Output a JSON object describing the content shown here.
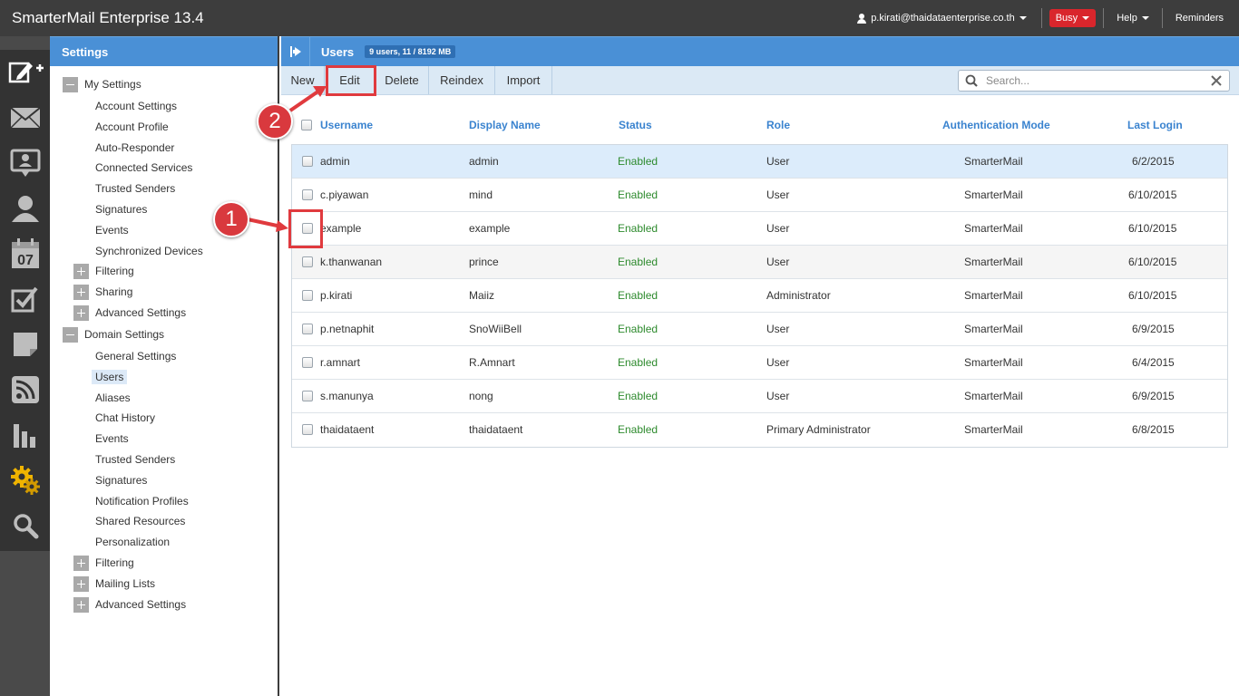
{
  "app": {
    "title": "SmarterMail Enterprise 13.4"
  },
  "topbar": {
    "user_email": "p.kirati@thaidataenterprise.co.th",
    "status_label": "Busy",
    "help_label": "Help",
    "reminders_label": "Reminders"
  },
  "rail": {
    "items": [
      "compose-icon",
      "mail-icon",
      "contacts-icon",
      "user-icon",
      "calendar-icon",
      "tasks-icon",
      "notes-icon",
      "rss-icon",
      "reports-icon",
      "settings-icon",
      "search-icon"
    ],
    "calendar_day": "07",
    "active": "settings-icon"
  },
  "settings": {
    "title": "Settings",
    "my_settings": {
      "label": "My Settings",
      "items": [
        "Account Settings",
        "Account Profile",
        "Auto-Responder",
        "Connected Services",
        "Trusted Senders",
        "Signatures",
        "Events",
        "Synchronized Devices"
      ],
      "groups": [
        "Filtering",
        "Sharing",
        "Advanced Settings"
      ]
    },
    "domain_settings": {
      "label": "Domain Settings",
      "items": [
        "General Settings",
        "Users",
        "Aliases",
        "Chat History",
        "Events",
        "Trusted Senders",
        "Signatures",
        "Notification Profiles",
        "Shared Resources",
        "Personalization"
      ],
      "groups": [
        "Filtering",
        "Mailing Lists",
        "Advanced Settings"
      ],
      "active_item": "Users"
    }
  },
  "main": {
    "title": "Users",
    "count_badge": "9 users, 11 / 8192 MB",
    "toolbar": {
      "new": "New",
      "edit": "Edit",
      "delete": "Delete",
      "reindex": "Reindex",
      "import": "Import"
    },
    "search": {
      "placeholder": "Search...",
      "value": ""
    },
    "columns": {
      "username": "Username",
      "display_name": "Display Name",
      "status": "Status",
      "role": "Role",
      "auth_mode": "Authentication Mode",
      "last_login": "Last Login"
    },
    "rows": [
      {
        "username": "admin",
        "display_name": "admin",
        "status": "Enabled",
        "role": "User",
        "auth_mode": "SmarterMail",
        "last_login": "6/2/2015"
      },
      {
        "username": "c.piyawan",
        "display_name": "mind",
        "status": "Enabled",
        "role": "User",
        "auth_mode": "SmarterMail",
        "last_login": "6/10/2015"
      },
      {
        "username": "example",
        "display_name": "example",
        "status": "Enabled",
        "role": "User",
        "auth_mode": "SmarterMail",
        "last_login": "6/10/2015"
      },
      {
        "username": "k.thanwanan",
        "display_name": "prince",
        "status": "Enabled",
        "role": "User",
        "auth_mode": "SmarterMail",
        "last_login": "6/10/2015"
      },
      {
        "username": "p.kirati",
        "display_name": "Maiiz",
        "status": "Enabled",
        "role": "Administrator",
        "auth_mode": "SmarterMail",
        "last_login": "6/10/2015"
      },
      {
        "username": "p.netnaphit",
        "display_name": "SnoWiiBell",
        "status": "Enabled",
        "role": "User",
        "auth_mode": "SmarterMail",
        "last_login": "6/9/2015"
      },
      {
        "username": "r.amnart",
        "display_name": "R.Amnart",
        "status": "Enabled",
        "role": "User",
        "auth_mode": "SmarterMail",
        "last_login": "6/4/2015"
      },
      {
        "username": "s.manunya",
        "display_name": "nong",
        "status": "Enabled",
        "role": "User",
        "auth_mode": "SmarterMail",
        "last_login": "6/9/2015"
      },
      {
        "username": "thaidataent",
        "display_name": "thaidataent",
        "status": "Enabled",
        "role": "Primary Administrator",
        "auth_mode": "SmarterMail",
        "last_login": "6/8/2015"
      }
    ]
  },
  "annotations": {
    "step1": "1",
    "step2": "2"
  },
  "colors": {
    "header_blue": "#4a90d6",
    "toolbar_blue": "#dbe9f5",
    "link_blue": "#3a83cf",
    "enabled_green": "#2d8a2d",
    "annotation_red": "#e03a3e",
    "busy_red": "#d9262c"
  }
}
